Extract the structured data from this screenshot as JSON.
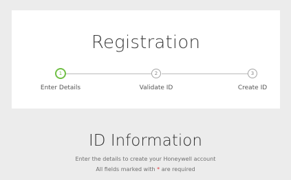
{
  "registration": {
    "title": "Registration",
    "steps": [
      {
        "number": "1",
        "label": "Enter Details",
        "state": "active"
      },
      {
        "number": "2",
        "label": "Validate ID",
        "state": "pending"
      },
      {
        "number": "3",
        "label": "Create ID",
        "state": "pending"
      }
    ]
  },
  "section": {
    "title": "ID Information",
    "description": "Enter the details to create your Honeywell account",
    "required_prefix": "All fields marked with",
    "required_marker": "*",
    "required_suffix": "are required"
  },
  "colors": {
    "active_step": "#6fbf44",
    "required_marker": "#e03a3e",
    "page_background": "#ececec",
    "card_background": "#ffffff"
  }
}
